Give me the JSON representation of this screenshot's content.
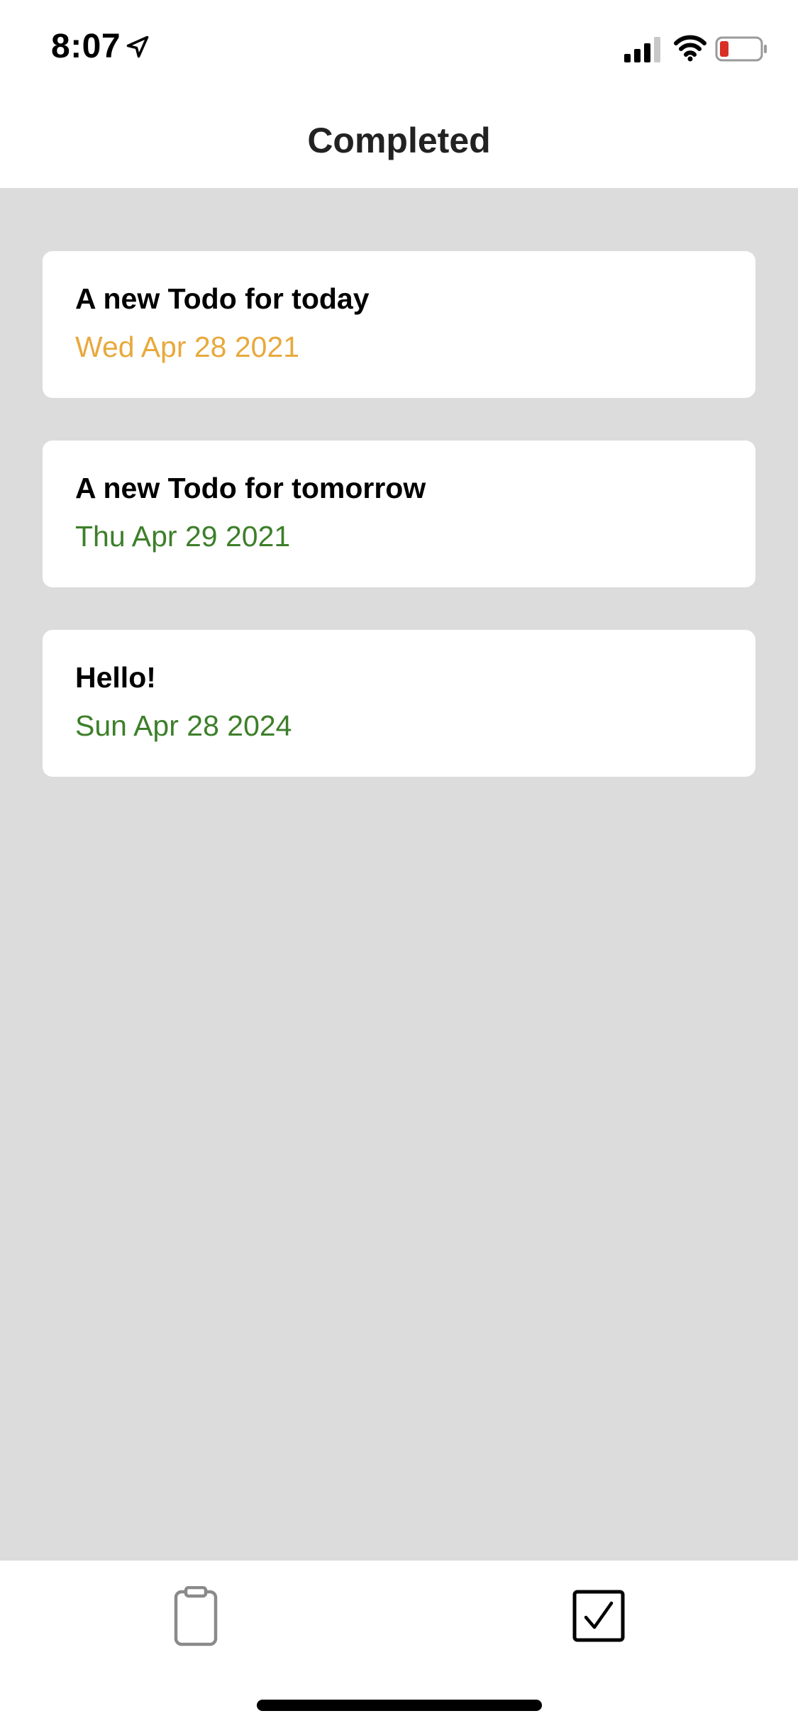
{
  "status_bar": {
    "time": "8:07",
    "icons": [
      "location-arrow-icon",
      "cellular-signal-icon",
      "wifi-icon",
      "battery-low-icon"
    ]
  },
  "nav": {
    "title": "Completed"
  },
  "todos": [
    {
      "title": "A new Todo for today",
      "date": "Wed Apr 28 2021",
      "date_color": "#e8a93c"
    },
    {
      "title": "A new Todo for tomorrow",
      "date": "Thu Apr 29 2021",
      "date_color": "#3d7f2a"
    },
    {
      "title": "Hello!",
      "date": "Sun Apr 28 2024",
      "date_color": "#3d7f2a"
    }
  ],
  "tab_bar": {
    "tabs": [
      {
        "icon": "clipboard-icon",
        "active": false
      },
      {
        "icon": "checkbox-checked-icon",
        "active": true
      }
    ]
  },
  "colors": {
    "list_background": "#dcdcdc",
    "card_background": "#ffffff",
    "due_today": "#e8a93c",
    "future": "#3d7f2a"
  }
}
